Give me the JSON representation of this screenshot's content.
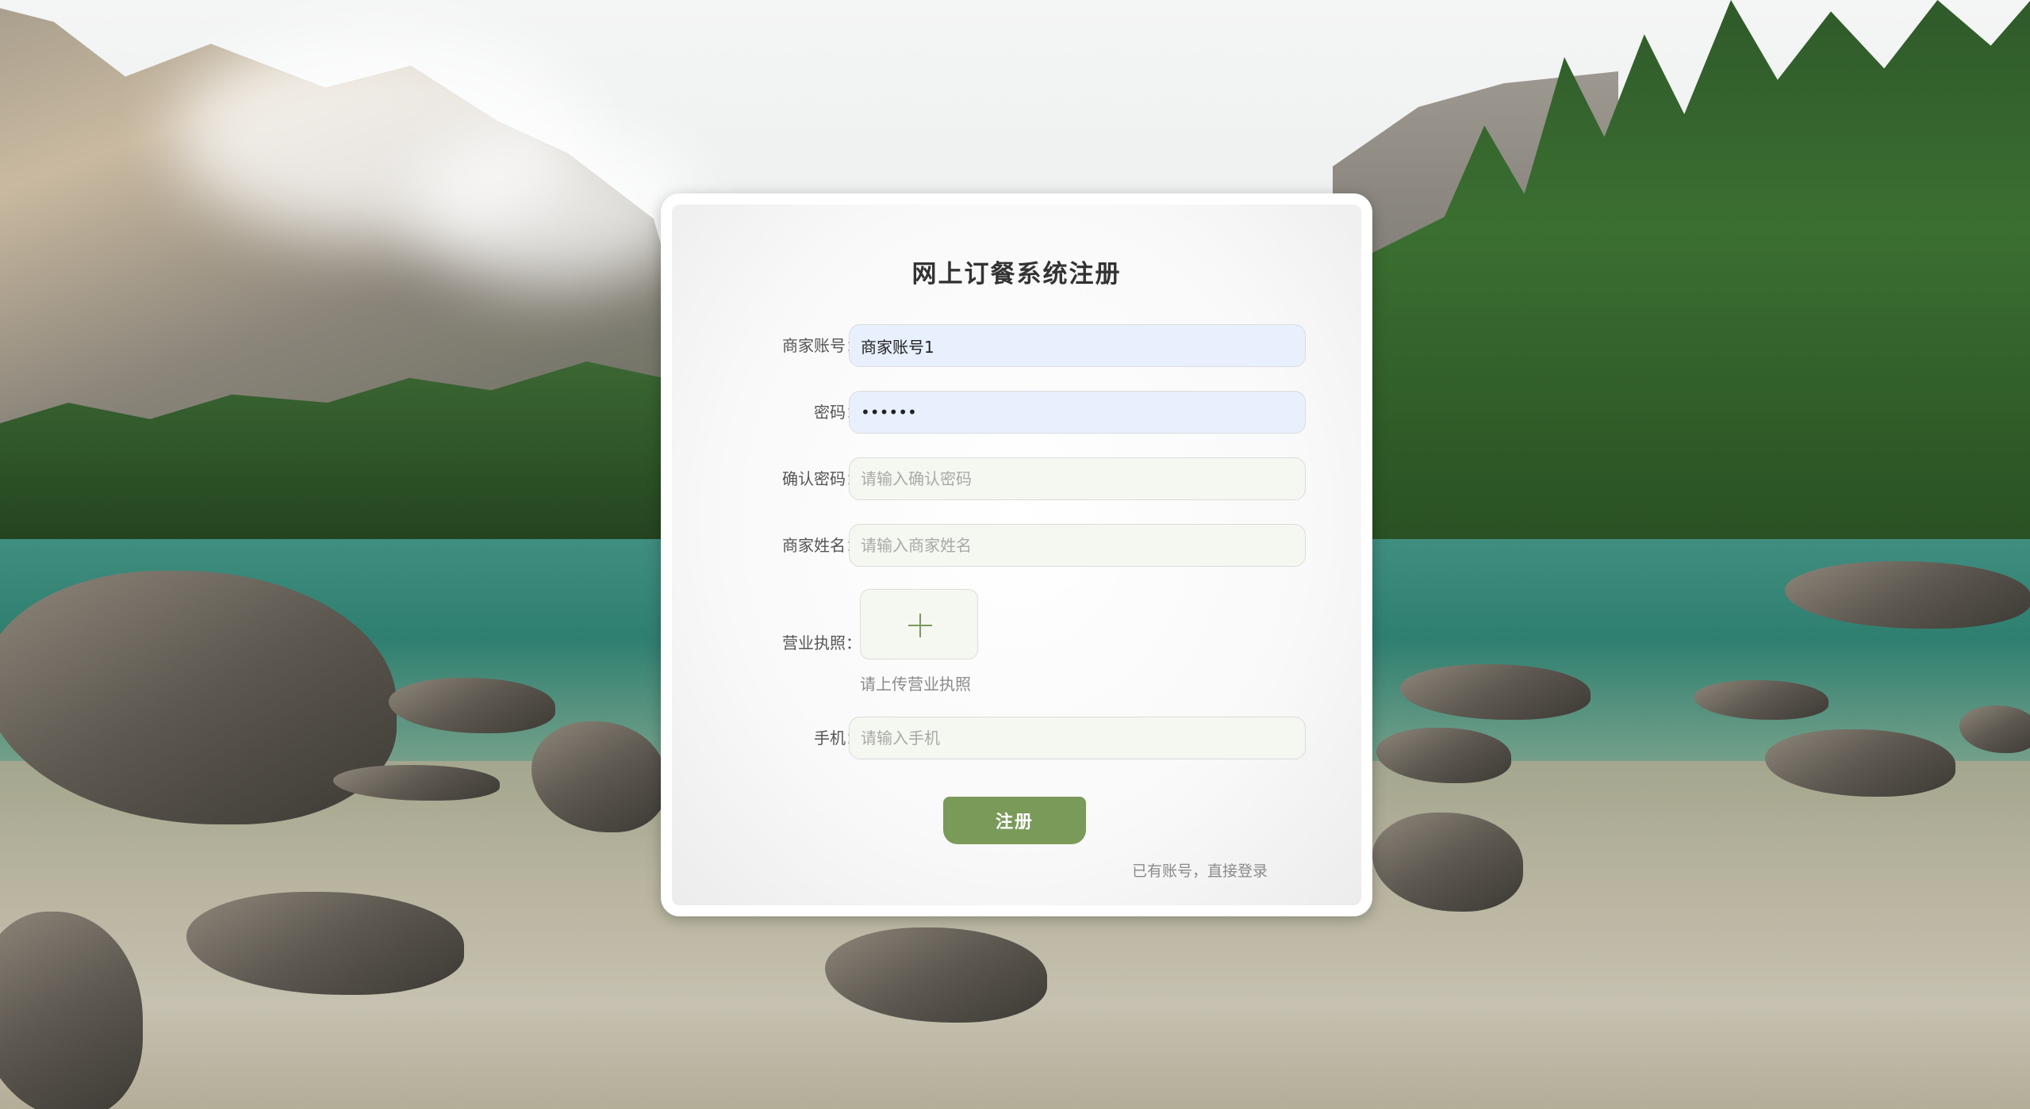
{
  "form": {
    "title": "网上订餐系统注册",
    "account": {
      "label": "商家账号：",
      "value": "商家账号1"
    },
    "password": {
      "label": "密码：",
      "value": "111111"
    },
    "confirm_password": {
      "label": "确认密码：",
      "placeholder": "请输入确认密码"
    },
    "merchant_name": {
      "label": "商家姓名：",
      "placeholder": "请输入商家姓名"
    },
    "license": {
      "label": "营业执照：",
      "hint": "请上传营业执照",
      "icon": "plus-icon"
    },
    "phone": {
      "label": "手机：",
      "placeholder": "请输入手机"
    },
    "submit_label": "注册",
    "login_link": "已有账号，直接登录"
  },
  "colors": {
    "accent": "#7a9a5a",
    "autofill_bg": "#e8f0fe",
    "field_bg": "#f5f7f1"
  }
}
